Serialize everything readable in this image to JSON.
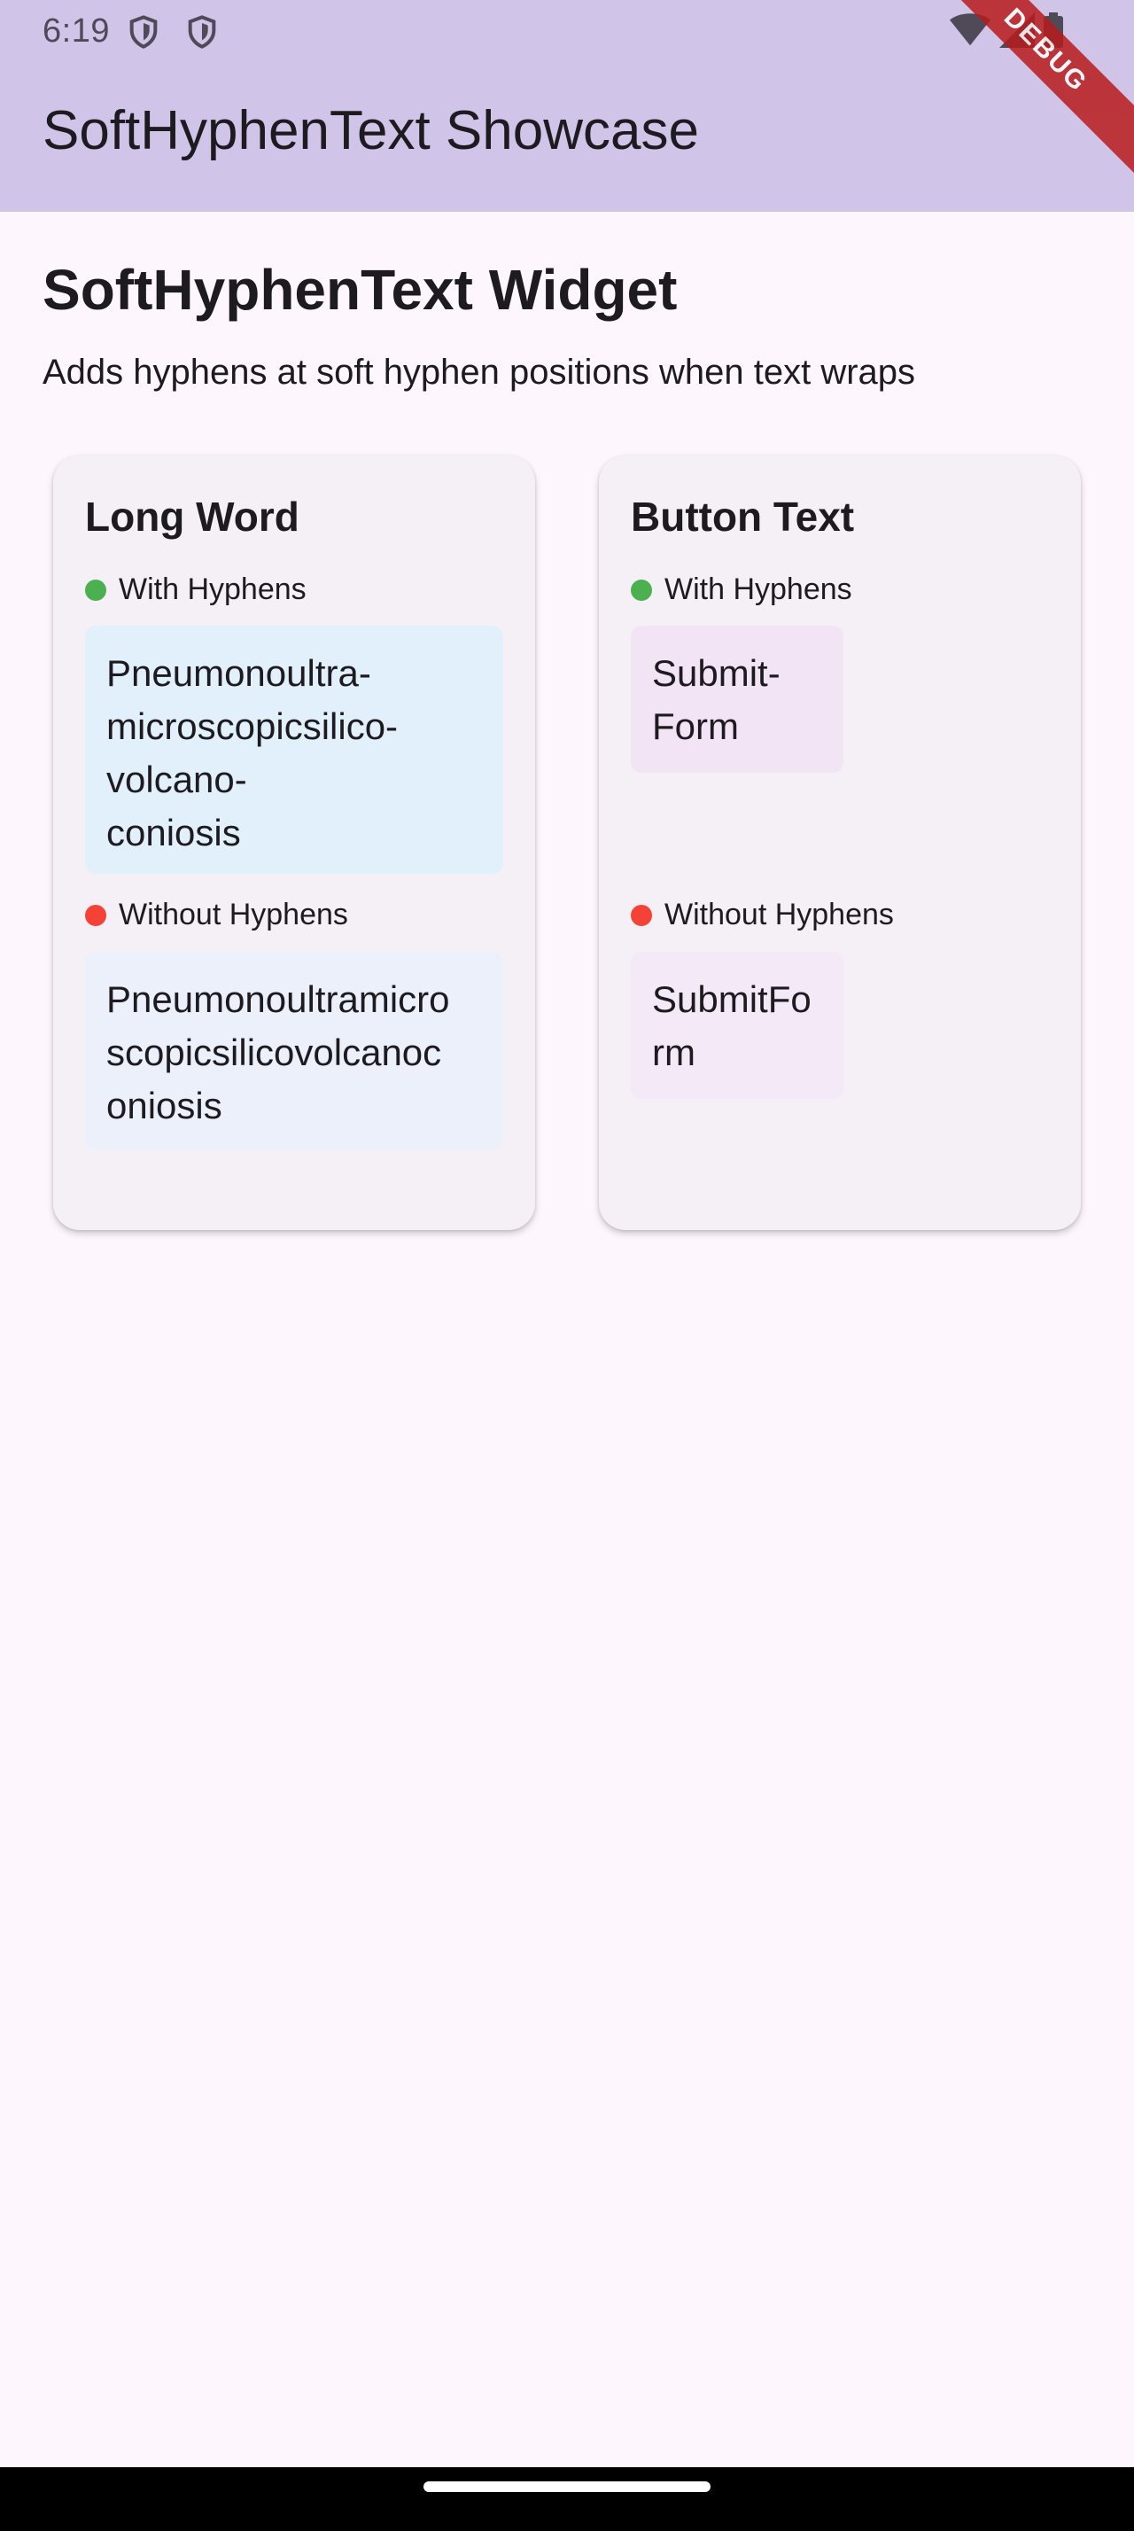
{
  "status_bar": {
    "time": "6:19",
    "icons": [
      "shield-icon",
      "shield-icon",
      "wifi-icon",
      "signal-icon",
      "battery-icon"
    ]
  },
  "app_bar": {
    "title": "SoftHyphenText Showcase",
    "color": "#d1c4e9"
  },
  "debug_banner": {
    "label": "DEBUG",
    "color": "#b71c1c"
  },
  "page": {
    "heading": "SoftHyphenText Widget",
    "subtitle": "Adds hyphens at soft hyphen positions when text wraps"
  },
  "cards": [
    {
      "title": "Long Word",
      "with_label": "With Hyphens",
      "with_text": "Pneumonoultra-\nmicroscopicsilico-\nvolcano-\nconiosis",
      "without_label": "Without Hyphens",
      "without_text": "Pneumonoultramicro\nscopicsilicovolcanoc\noniosis"
    },
    {
      "title": "Button Text",
      "with_label": "With Hyphens",
      "with_text": "Submit-\nForm",
      "without_label": "Without Hyphens",
      "without_text": "SubmitFo\nrm"
    }
  ],
  "colors": {
    "with_dot": "#4caf50",
    "without_dot": "#f44336",
    "background": "#fdf7fd",
    "card": "#f5eff6"
  }
}
